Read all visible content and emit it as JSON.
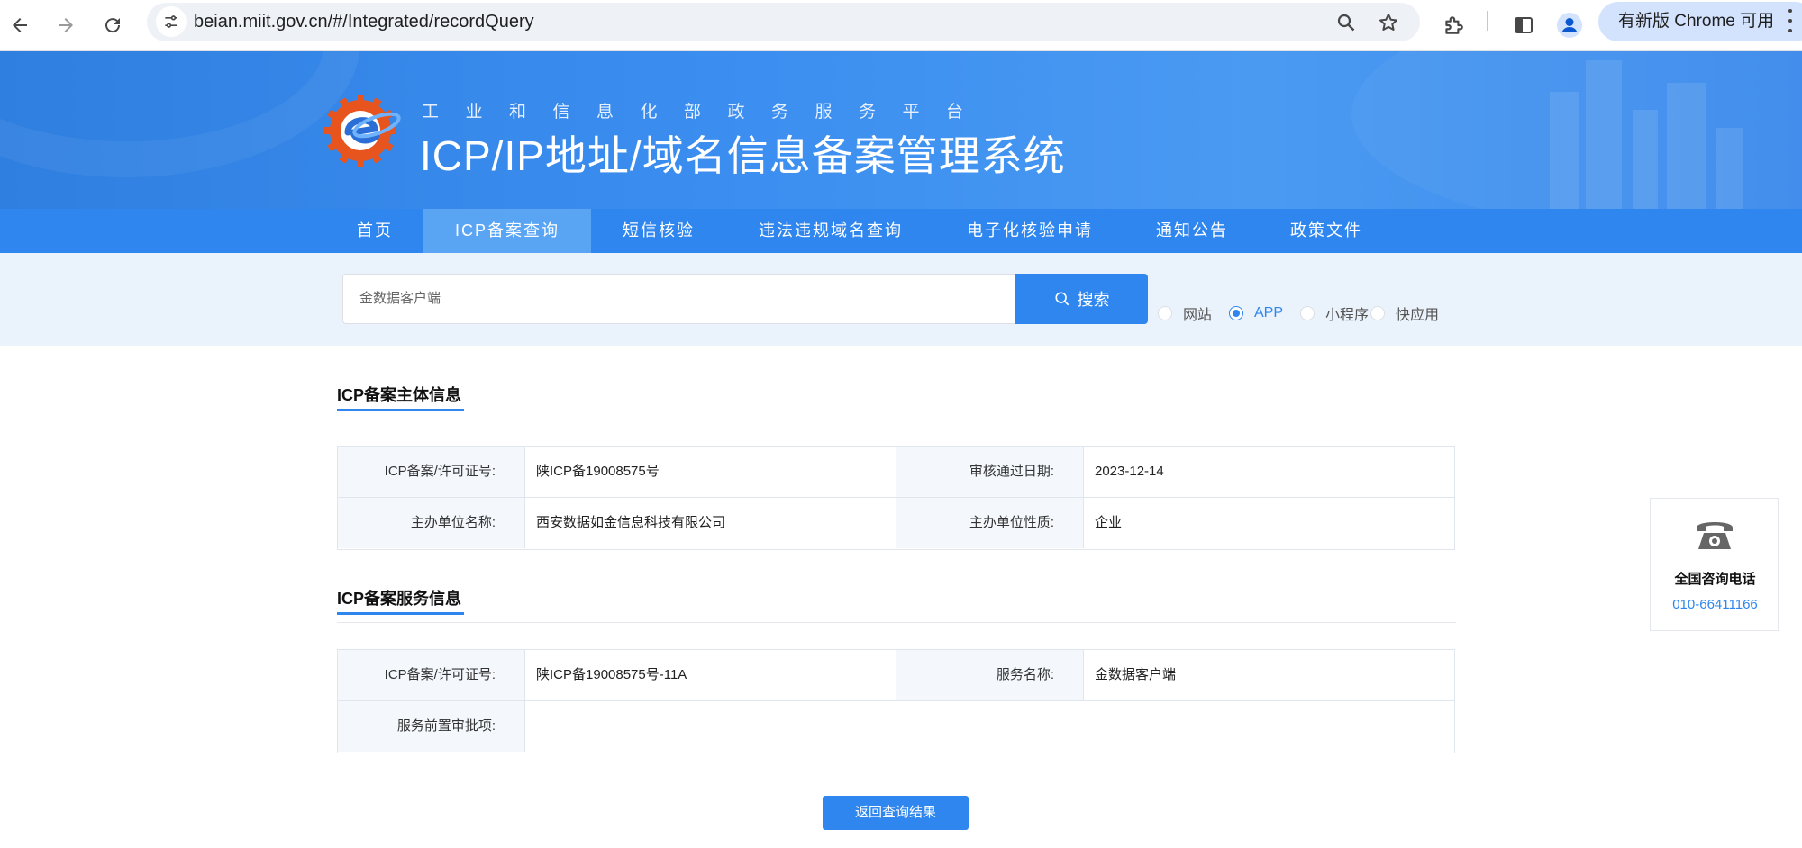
{
  "browser": {
    "url": "beian.miit.gov.cn/#/Integrated/recordQuery",
    "update_label": "有新版 Chrome 可用",
    "icons": [
      "back-icon",
      "forward-icon",
      "reload-icon",
      "site-info-icon",
      "zoom-icon",
      "bookmark-star-icon",
      "extensions-icon",
      "side-panel-icon",
      "profile-icon",
      "menu-icon"
    ]
  },
  "header": {
    "subtitle": "工业和信息化部政务服务平台",
    "title": "ICP/IP地址/域名信息备案管理系统"
  },
  "nav": {
    "items": [
      {
        "label": "首页",
        "active": false
      },
      {
        "label": "ICP备案查询",
        "active": true
      },
      {
        "label": "短信核验",
        "active": false
      },
      {
        "label": "违法违规域名查询",
        "active": false
      },
      {
        "label": "电子化核验申请",
        "active": false
      },
      {
        "label": "通知公告",
        "active": false
      },
      {
        "label": "政策文件",
        "active": false
      }
    ]
  },
  "search": {
    "value": "金数据客户端",
    "button_label": "搜索",
    "types": [
      {
        "label": "网站",
        "checked": false
      },
      {
        "label": "APP",
        "checked": true
      },
      {
        "label": "小程序",
        "checked": false
      },
      {
        "label": "快应用",
        "checked": false
      }
    ]
  },
  "subject_info": {
    "title": "ICP备案主体信息",
    "license_label": "ICP备案/许可证号:",
    "license_value": "陕ICP备19008575号",
    "approve_label": "审核通过日期:",
    "approve_value": "2023-12-14",
    "org_label": "主办单位名称:",
    "org_value": "西安数据如金信息科技有限公司",
    "nature_label": "主办单位性质:",
    "nature_value": "企业"
  },
  "service_info": {
    "title": "ICP备案服务信息",
    "license_label": "ICP备案/许可证号:",
    "license_value": "陕ICP备19008575号-11A",
    "name_label": "服务名称:",
    "name_value": "金数据客户端",
    "pre_approval_label": "服务前置审批项:",
    "pre_approval_value": ""
  },
  "back_button": "返回查询结果",
  "hotline": {
    "title": "全国咨询电话",
    "number": "010-66411166"
  },
  "colors": {
    "primary": "#2e86ee",
    "nav_active": "#5aa4f4",
    "search_bg": "#eaf2fb",
    "label_cell_bg": "#f4f8fd"
  }
}
